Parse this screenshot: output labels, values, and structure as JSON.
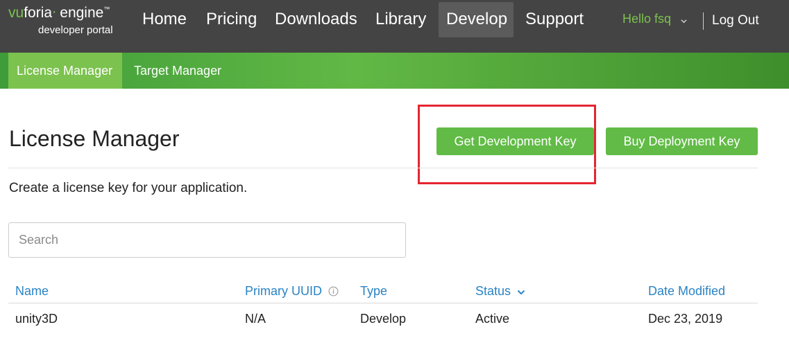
{
  "brand": {
    "name_prefix": "vu",
    "name_rest": "foria",
    "product": "engine",
    "tm": "™",
    "subtitle": "developer portal",
    "accent_color": "#7cc24e"
  },
  "nav": {
    "items": [
      {
        "label": "Home"
      },
      {
        "label": "Pricing"
      },
      {
        "label": "Downloads"
      },
      {
        "label": "Library"
      },
      {
        "label": "Develop",
        "active": true
      },
      {
        "label": "Support"
      }
    ],
    "user_greeting": "Hello fsq",
    "logout_label": "Log Out",
    "dropdown_icon": "chevron-down-icon"
  },
  "subnav": {
    "items": [
      {
        "label": "License Manager",
        "active": true
      },
      {
        "label": "Target Manager"
      }
    ]
  },
  "main": {
    "title": "License Manager",
    "get_dev_key_label": "Get Development Key",
    "buy_deploy_key_label": "Buy Deployment Key",
    "description": "Create a license key for your application.",
    "search_placeholder": "Search",
    "highlight_color": "#e52431",
    "button_color": "#61bb46"
  },
  "table": {
    "columns": [
      "Name",
      "Primary UUID",
      "Type",
      "Status",
      "Date Modified"
    ],
    "uuid_info_icon": "info-icon",
    "status_sort_icon": "chevron-down-icon",
    "rows": [
      {
        "name": "unity3D",
        "uuid": "N/A",
        "type": "Develop",
        "status": "Active",
        "date": "Dec 23, 2019"
      }
    ]
  }
}
